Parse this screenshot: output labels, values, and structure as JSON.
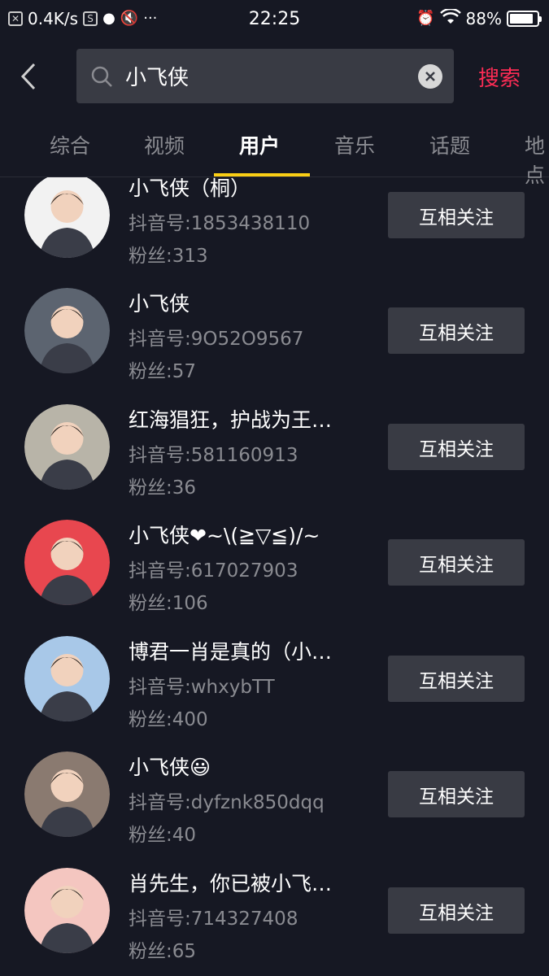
{
  "status_bar": {
    "net_speed": "0.4K/s",
    "time": "22:25",
    "battery": "88%",
    "battery_level": 0.88
  },
  "search": {
    "query": "小飞侠",
    "submit_label": "搜索"
  },
  "tabs": [
    {
      "label": "综合"
    },
    {
      "label": "视频"
    },
    {
      "label": "用户"
    },
    {
      "label": "音乐"
    },
    {
      "label": "话题"
    },
    {
      "label": "地点"
    }
  ],
  "active_tab": "用户",
  "users": [
    {
      "name": "小飞侠（桐）",
      "id": "抖音号:1853438110",
      "fans": "粉丝:313",
      "button": "互相关注",
      "avatar_color": "#f2f2f2"
    },
    {
      "name": "小飞侠",
      "id": "抖音号:9O52O9567",
      "fans": "粉丝:57",
      "button": "互相关注",
      "avatar_color": "#5c6470"
    },
    {
      "name": "红海猖狂，护战为王…",
      "id": "抖音号:581160913",
      "fans": "粉丝:36",
      "button": "互相关注",
      "avatar_color": "#b8b4a8"
    },
    {
      "name": "小飞侠❤~\\(≧▽≦)/~",
      "id": "抖音号:617027903",
      "fans": "粉丝:106",
      "button": "互相关注",
      "avatar_color": "#e8474f"
    },
    {
      "name": "博君一肖是真的（小…",
      "id": "抖音号:whxybTT",
      "fans": "粉丝:400",
      "button": "互相关注",
      "avatar_color": "#a8c8e8"
    },
    {
      "name": "小飞侠😃",
      "id": "抖音号:dyfznk850dqq",
      "fans": "粉丝:40",
      "button": "互相关注",
      "avatar_color": "#8a7a70"
    },
    {
      "name": "肖先生，你已被小飞…",
      "id": "抖音号:714327408",
      "fans": "粉丝:65",
      "button": "互相关注",
      "avatar_color": "#f4c6c0"
    }
  ]
}
